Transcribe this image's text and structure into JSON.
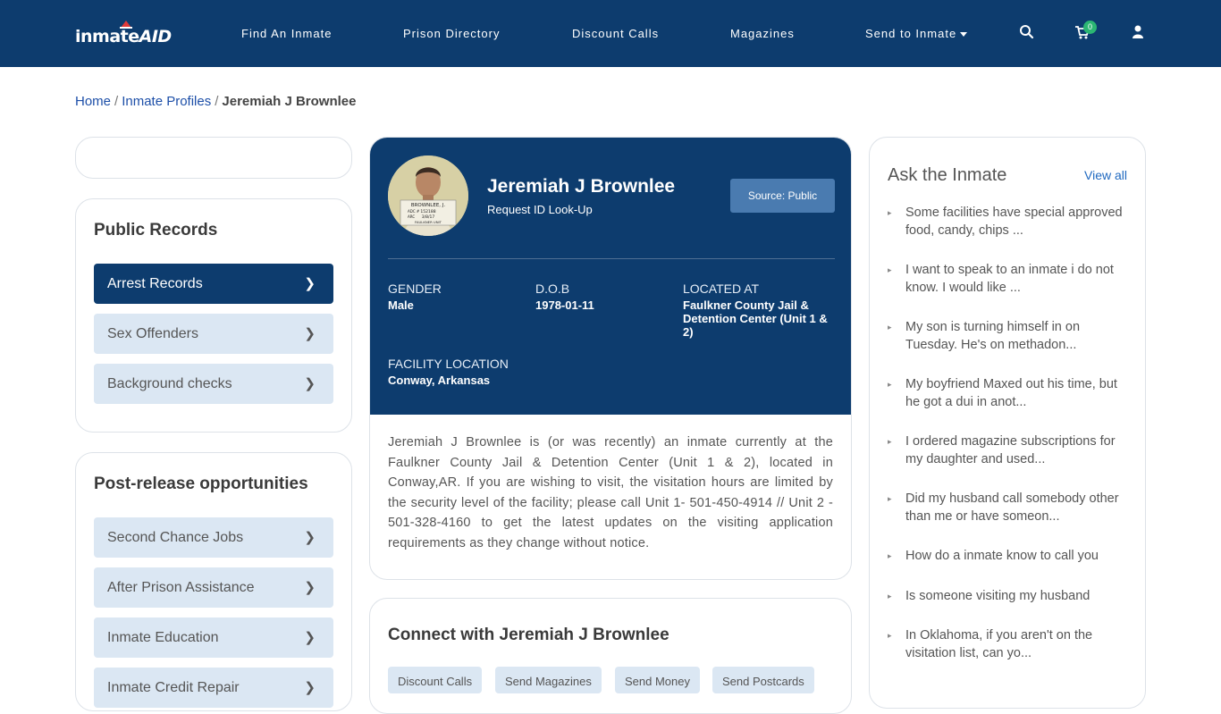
{
  "brand": {
    "logo_text_a": "inmate",
    "logo_text_b": "AID"
  },
  "nav": {
    "items": [
      "Find An Inmate",
      "Prison Directory",
      "Discount Calls",
      "Magazines",
      "Send to Inmate"
    ],
    "cart_count": "0"
  },
  "breadcrumb": {
    "home": "Home",
    "profiles": "Inmate Profiles",
    "current": "Jeremiah J Brownlee",
    "sep": "/"
  },
  "sidebar": {
    "public_records": {
      "title": "Public Records",
      "items": [
        {
          "label": "Arrest Records",
          "active": true
        },
        {
          "label": "Sex Offenders",
          "active": false
        },
        {
          "label": "Background checks",
          "active": false
        }
      ]
    },
    "post_release": {
      "title": "Post-release opportunities",
      "items": [
        {
          "label": "Second Chance Jobs"
        },
        {
          "label": "After Prison Assistance"
        },
        {
          "label": "Inmate Education"
        },
        {
          "label": "Inmate Credit Repair"
        }
      ]
    },
    "chevron": "❯"
  },
  "profile": {
    "name": "Jeremiah J Brownlee",
    "sub": "Request ID Look-Up",
    "source": "Source: Public",
    "gender_label": "GENDER",
    "gender": "Male",
    "dob_label": "D.O.B",
    "dob": "1978-01-11",
    "located_label": "LOCATED AT",
    "located": "Faulkner County Jail & Detention Center (Unit 1 & 2)",
    "facility_label": "FACILITY LOCATION",
    "facility": "Conway, Arkansas",
    "description": "Jeremiah J Brownlee is (or was recently) an inmate currently at the Faulkner County Jail & Detention Center (Unit 1 & 2), located in Conway,AR. If you are wishing to visit, the visitation hours are limited by the security level of the facility; please call Unit 1- 501-450-4914 // Unit 2 - 501-328-4160 to get the latest updates on the visiting application requirements as they change without notice.",
    "photo_text": {
      "name": "BROWNLEE, J.",
      "adc_label": "ADC #",
      "adc": "152188",
      "arc_label": "ARC",
      "date": "3/8/17",
      "unit": "FAULKNER UNIT"
    }
  },
  "connect": {
    "title": "Connect with Jeremiah J Brownlee",
    "pills": [
      "Discount Calls",
      "Send Magazines",
      "Send Money",
      "Send Postcards"
    ]
  },
  "ask": {
    "title": "Ask the Inmate",
    "view_all": "View all",
    "bullet": "▸",
    "questions": [
      "Some facilities have special approved food, candy, chips ...",
      "I want to speak to an inmate i do not know. I would like ...",
      "My son is turning himself in on Tuesday. He's on methadon...",
      "My boyfriend Maxed out his time, but he got a dui in anot...",
      "I ordered magazine subscriptions for my daughter and used...",
      "Did my husband call somebody other than me or have someon...",
      "How do a inmate know to call you",
      "Is someone visiting my husband",
      "In Oklahoma, if you aren't on the visitation list, can yo..."
    ]
  },
  "colors": {
    "navy": "#0d3c6e",
    "light_blue": "#dbe7f3",
    "badge_green": "#2bb673",
    "link": "#1d4fa8"
  }
}
